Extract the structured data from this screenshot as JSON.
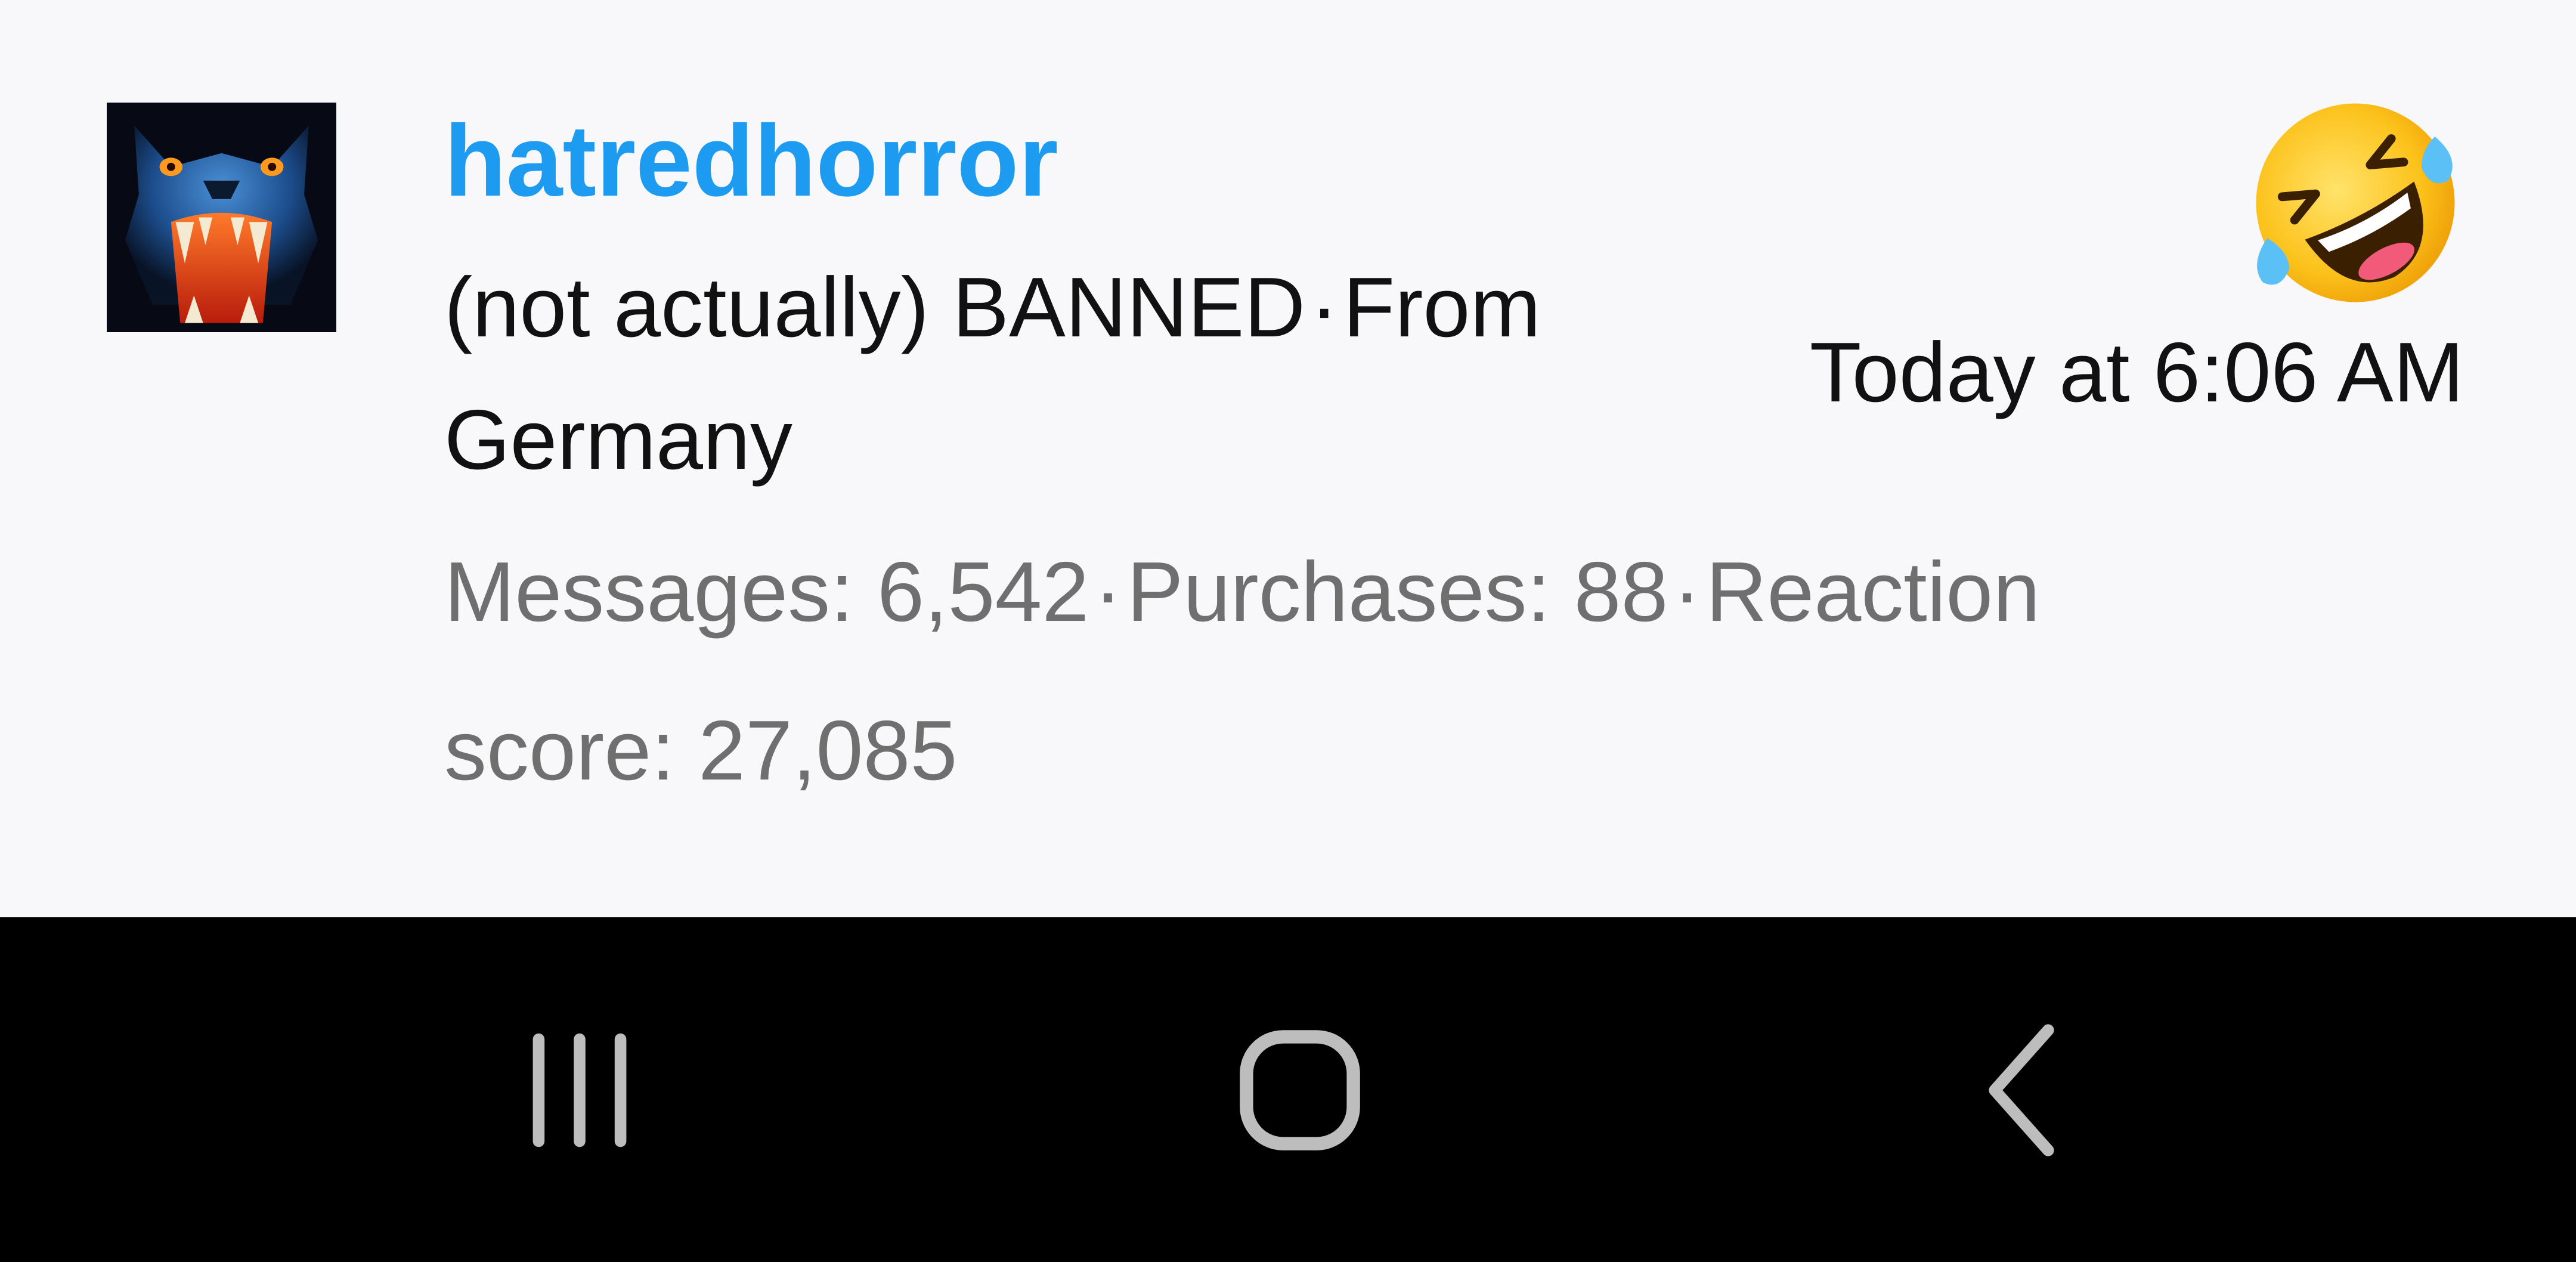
{
  "post": {
    "username": "hatredhorror",
    "user_title": "(not actually) BANNED",
    "separator": "·",
    "location": "From Germany",
    "stats": {
      "messages": "Messages: 6,542",
      "purchases": "Purchases: 88",
      "reaction_score": "Reaction score: 27,085"
    },
    "timestamp": "Today at 6:06 AM",
    "reaction_emoji": "rolling-on-floor-laughing-icon"
  },
  "colors": {
    "username": "#1d9bf0",
    "stats_text": "#6f6f6f",
    "primary_text": "#111111",
    "background": "#f8f8fa",
    "nav_bar": "#000000",
    "nav_icon": "#bdbdbd"
  },
  "nav_bar": {
    "recents_icon": "recents-icon",
    "home_icon": "home-icon",
    "back_icon": "back-icon"
  }
}
